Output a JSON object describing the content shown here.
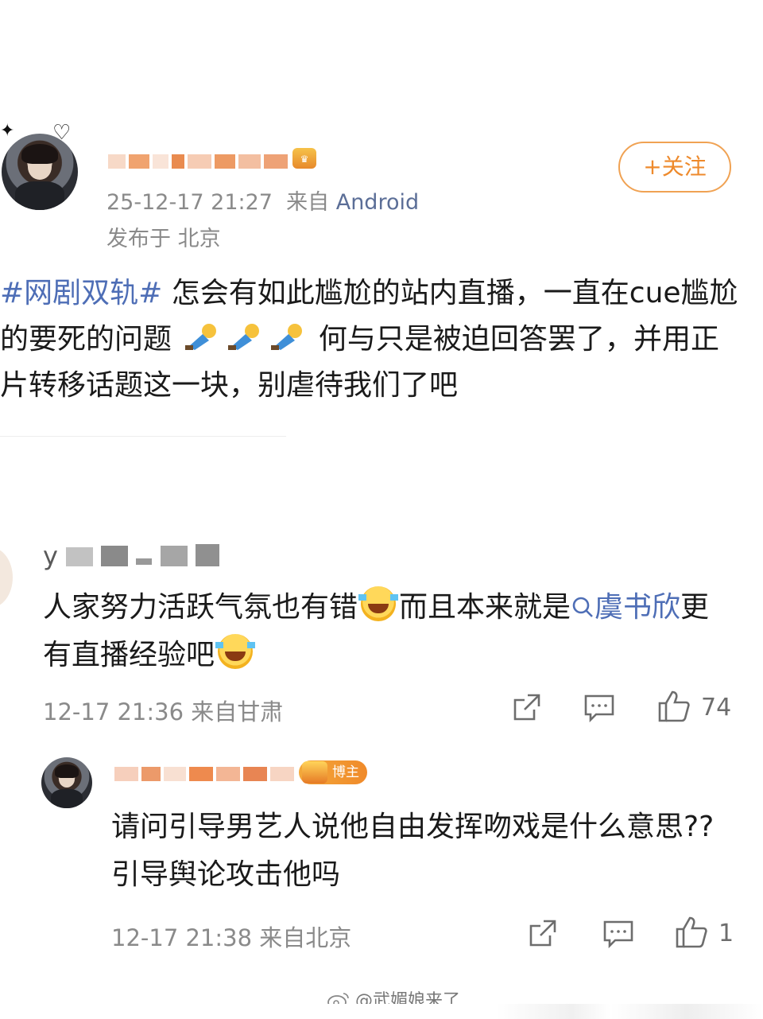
{
  "post": {
    "author_blurred": true,
    "timestamp": "25-12-17 21:27",
    "source_prefix": "来自",
    "source_app": "Android",
    "location": "发布于 北京",
    "follow_label": "+关注",
    "hashtag": "#网剧双轨#",
    "text_1": "怎会有如此尴尬的站内直播，一直在cue尴尬的要死的问题",
    "text_2": "何与只是被迫回答罢了，",
    "text_3": "并用正片转移话题这一块，别虐待我们了吧"
  },
  "comments": [
    {
      "name": "y",
      "text_1": "人家努力活跃气氛也有错",
      "text_2": "而且本来就是",
      "link": "虞书欣",
      "text_3": "更有直播经验吧",
      "meta": "12-17 21:36 来自甘肃",
      "likes": "74"
    },
    {
      "name": "",
      "badge": "博主",
      "text": "请问引导男艺人说他自由发挥吻戏是什么意思??引导舆论攻击他吗",
      "meta": "12-17 21:38 来自北京",
      "likes": "1"
    }
  ],
  "watermark": "@武媚娘来了",
  "icons": [
    "share-icon",
    "comment-icon",
    "like-icon",
    "search-icon",
    "weibo-logo-icon"
  ]
}
